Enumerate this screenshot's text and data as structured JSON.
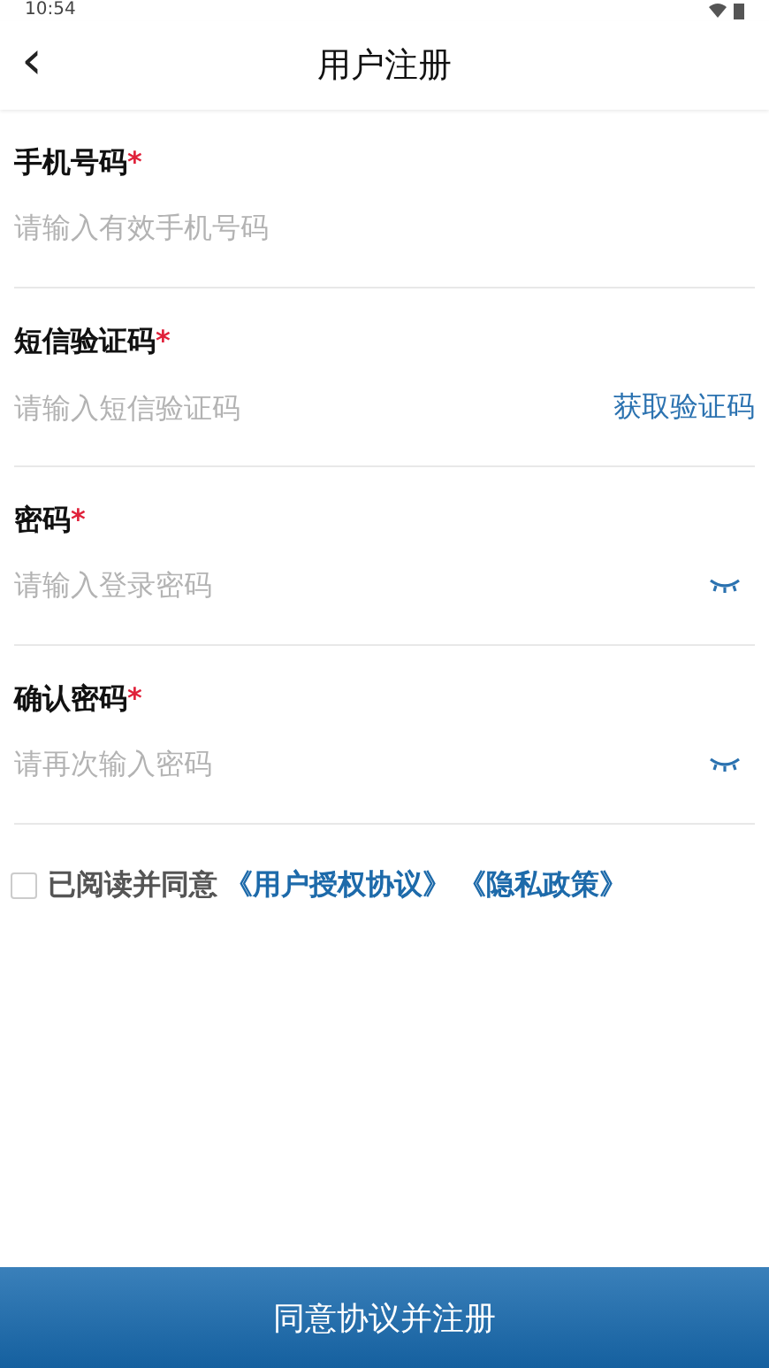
{
  "status_bar": {
    "time": "10:54"
  },
  "header": {
    "back_icon": "‹",
    "title": "用户注册"
  },
  "fields": [
    {
      "kind": "text",
      "label": "手机号码",
      "required_mark": "*",
      "placeholder": "请输入有效手机号码"
    },
    {
      "kind": "code",
      "label": "短信验证码",
      "required_mark": "*",
      "placeholder": "请输入短信验证码",
      "action": "获取验证码"
    },
    {
      "kind": "password",
      "label": "密码",
      "required_mark": "*",
      "placeholder": "请输入登录密码"
    },
    {
      "kind": "password",
      "label": "确认密码",
      "required_mark": "*",
      "placeholder": "请再次输入密码"
    }
  ],
  "agreement": {
    "checked": false,
    "text": "已阅读并同意",
    "links": [
      "《用户授权协议》",
      "《隐私政策》"
    ]
  },
  "submit": {
    "label": "同意协议并注册"
  }
}
